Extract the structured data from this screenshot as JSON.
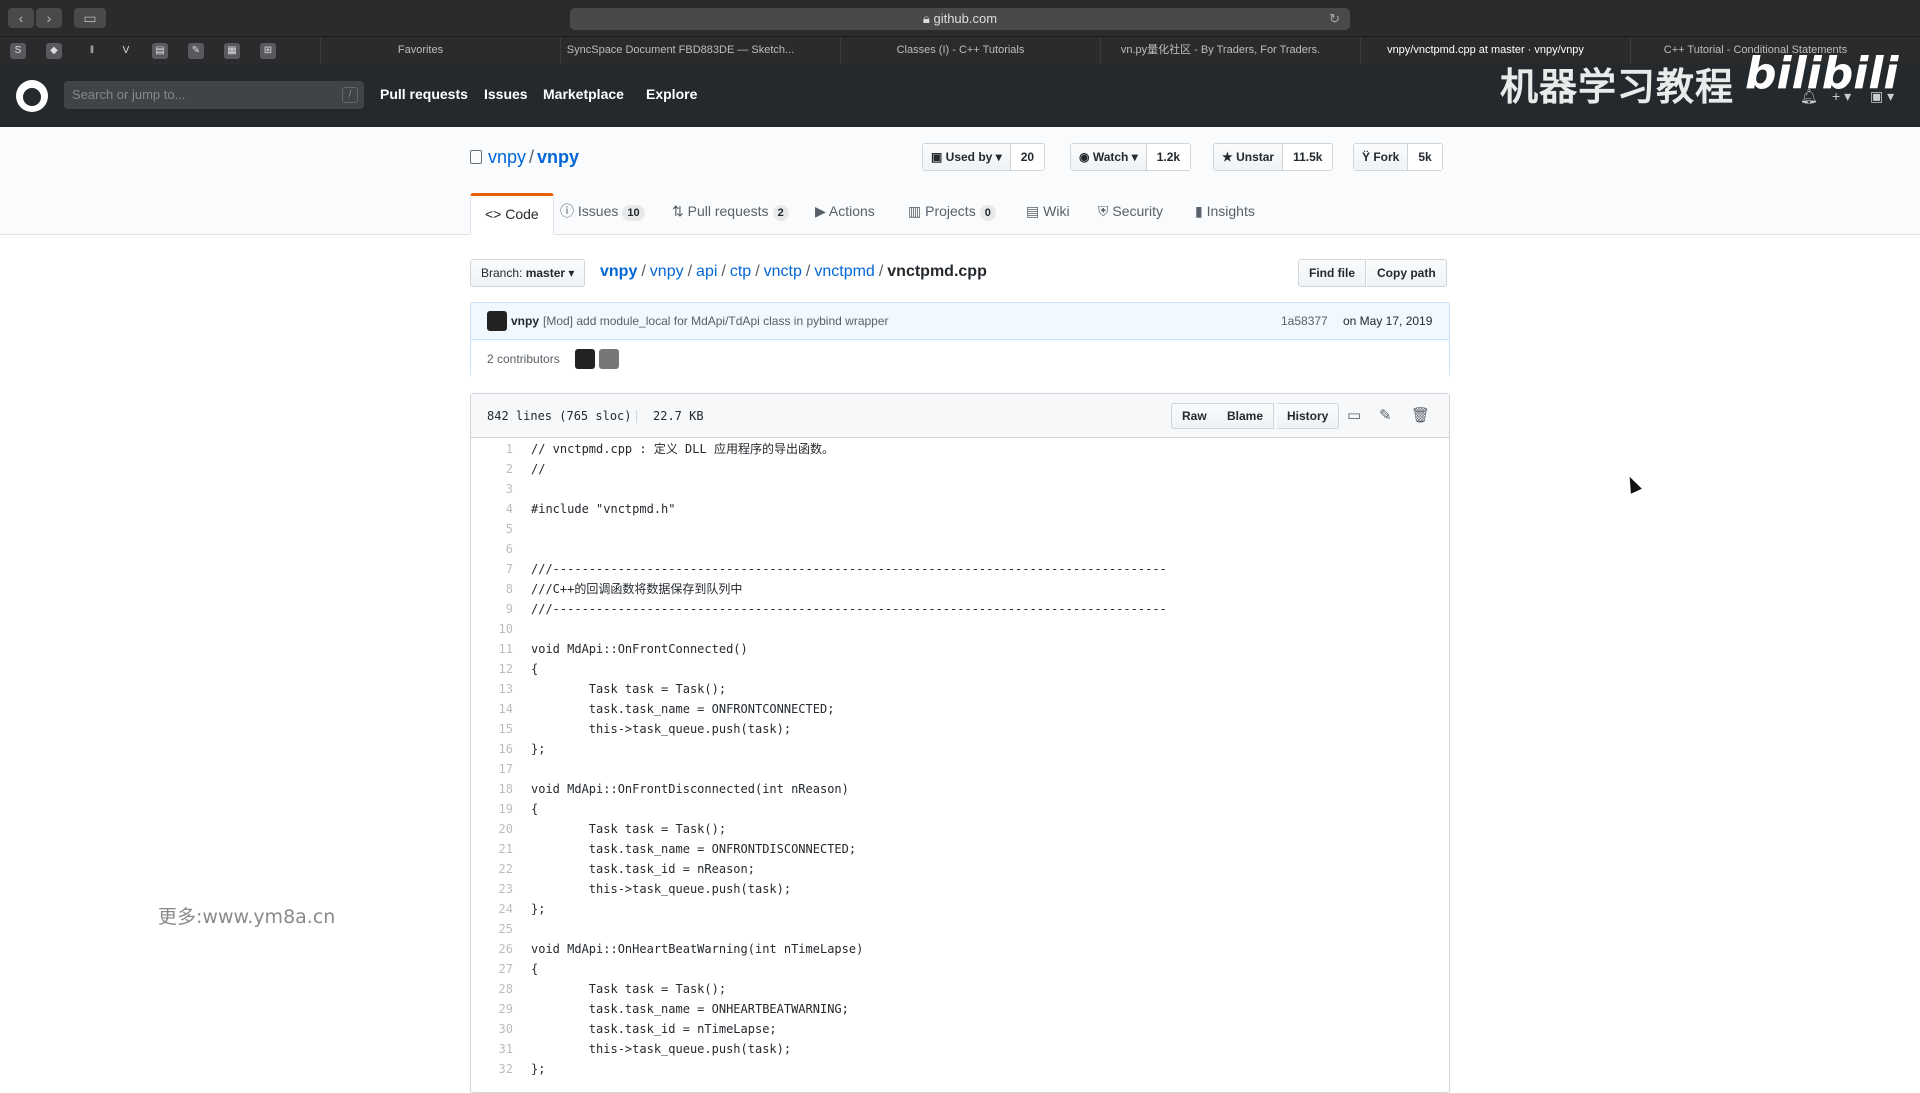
{
  "browser": {
    "url": "github.com",
    "tabs": [
      "Favorites",
      "SyncSpace Document FBD883DE — Sketch...",
      "Classes (I) - C++ Tutorials",
      "vn.py量化社区 - By Traders, For Traders.",
      "vnpy/vnctpmd.cpp at master · vnpy/vnpy",
      "C++ Tutorial - Conditional Statements"
    ]
  },
  "header": {
    "search_placeholder": "Search or jump to...",
    "search_key": "/",
    "nav": [
      "Pull requests",
      "Issues",
      "Marketplace",
      "Explore"
    ],
    "watermark": "机器学习教程",
    "bili_logo": "bilibili"
  },
  "repo": {
    "owner": "vnpy",
    "name": "vnpy",
    "used_by_label": "Used by",
    "used_by_count": "20",
    "watch_label": "Watch",
    "watch_count": "1.2k",
    "star_label": "Unstar",
    "star_count": "11.5k",
    "fork_label": "Fork",
    "fork_count": "5k",
    "tabs": {
      "code": "Code",
      "issues": "Issues",
      "issues_count": "10",
      "pulls": "Pull requests",
      "pulls_count": "2",
      "actions": "Actions",
      "projects": "Projects",
      "projects_count": "0",
      "wiki": "Wiki",
      "security": "Security",
      "insights": "Insights"
    }
  },
  "file_nav": {
    "branch_label": "Branch:",
    "branch": "master",
    "path": [
      "vnpy",
      "vnpy",
      "api",
      "ctp",
      "vnctp",
      "vnctpmd"
    ],
    "filename": "vnctpmd.cpp",
    "find_file": "Find file",
    "copy_path": "Copy path"
  },
  "commit": {
    "author": "vnpy",
    "message": "[Mod] add module_local for MdApi/TdApi class in pybind wrapper",
    "sha": "1a58377",
    "date": "on May 17, 2019",
    "contributors": "2 contributors"
  },
  "file": {
    "lines_info": "842 lines (765 sloc)",
    "size": "22.7 KB",
    "raw": "Raw",
    "blame": "Blame",
    "history": "History",
    "code": [
      "// vnctpmd.cpp : 定义 DLL 应用程序的导出函数。",
      "//",
      "",
      "#include \"vnctpmd.h\"",
      "",
      "",
      "///-------------------------------------------------------------------------------------",
      "///C++的回调函数将数据保存到队列中",
      "///-------------------------------------------------------------------------------------",
      "",
      "void MdApi::OnFrontConnected()",
      "{",
      "\tTask task = Task();",
      "\ttask.task_name = ONFRONTCONNECTED;",
      "\tthis->task_queue.push(task);",
      "};",
      "",
      "void MdApi::OnFrontDisconnected(int nReason)",
      "{",
      "\tTask task = Task();",
      "\ttask.task_name = ONFRONTDISCONNECTED;",
      "\ttask.task_id = nReason;",
      "\tthis->task_queue.push(task);",
      "};",
      "",
      "void MdApi::OnHeartBeatWarning(int nTimeLapse)",
      "{",
      "\tTask task = Task();",
      "\ttask.task_name = ONHEARTBEATWARNING;",
      "\ttask.task_id = nTimeLapse;",
      "\tthis->task_queue.push(task);",
      "};"
    ]
  },
  "overlay_text": "更多:www.ym8a.cn"
}
